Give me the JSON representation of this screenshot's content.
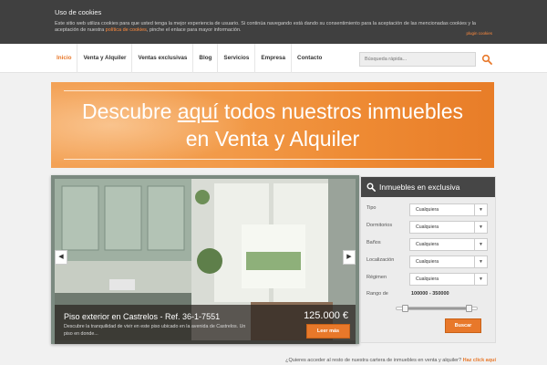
{
  "cookie": {
    "title": "Uso de cookies",
    "text_before": "Este sitio web utiliza cookies para que usted tenga la mejor experiencia de usuario. Si continúa navegando está dando su consentimiento para la aceptación de las mencionadas cookies y la aceptación de nuestra ",
    "link": "política de cookies",
    "text_after": ", pinche el enlace para mayor información.",
    "plugin": "plugin cookies"
  },
  "nav": {
    "items": [
      "Inicio",
      "Venta y Alquiler",
      "Ventas exclusivas",
      "Blog",
      "Servicios",
      "Empresa",
      "Contacto"
    ],
    "active": "Inicio"
  },
  "search": {
    "placeholder": "Búsqueda rápida..."
  },
  "banner": {
    "line1_before": "Descubre ",
    "line1_underlined": "aquí",
    "line1_after": " todos nuestros inmuebles",
    "line2": "en Venta y Alquiler"
  },
  "slider": {
    "title": "Piso exterior en Castrelos - Ref. 36-1-7551",
    "description": "Descubre la tranquilidad de vivir en este piso ubicado en la avenida de Castrelos. Un piso en donde...",
    "price": "125.000 €",
    "button": "Leer más"
  },
  "panel": {
    "title": "Inmuebles en exclusiva",
    "fields": [
      {
        "label": "Tipo",
        "value": "Cualquiera"
      },
      {
        "label": "Dormitorios",
        "value": "Cualquiera"
      },
      {
        "label": "Baños",
        "value": "Cualquiera"
      },
      {
        "label": "Localización",
        "value": "Cualquiera"
      },
      {
        "label": "Régimen",
        "value": "Cualquiera"
      }
    ],
    "range_label": "Rango de",
    "range_value": "100000 - 350000",
    "button": "Buscar"
  },
  "footer": {
    "question": "¿Quieres acceder al resto de nuestra cartera de inmuebles en venta y alquiler? ",
    "link": "Haz click aquí"
  },
  "colors": {
    "accent": "#e8782a",
    "dark_bar": "#404040",
    "panel_header": "#464646"
  }
}
